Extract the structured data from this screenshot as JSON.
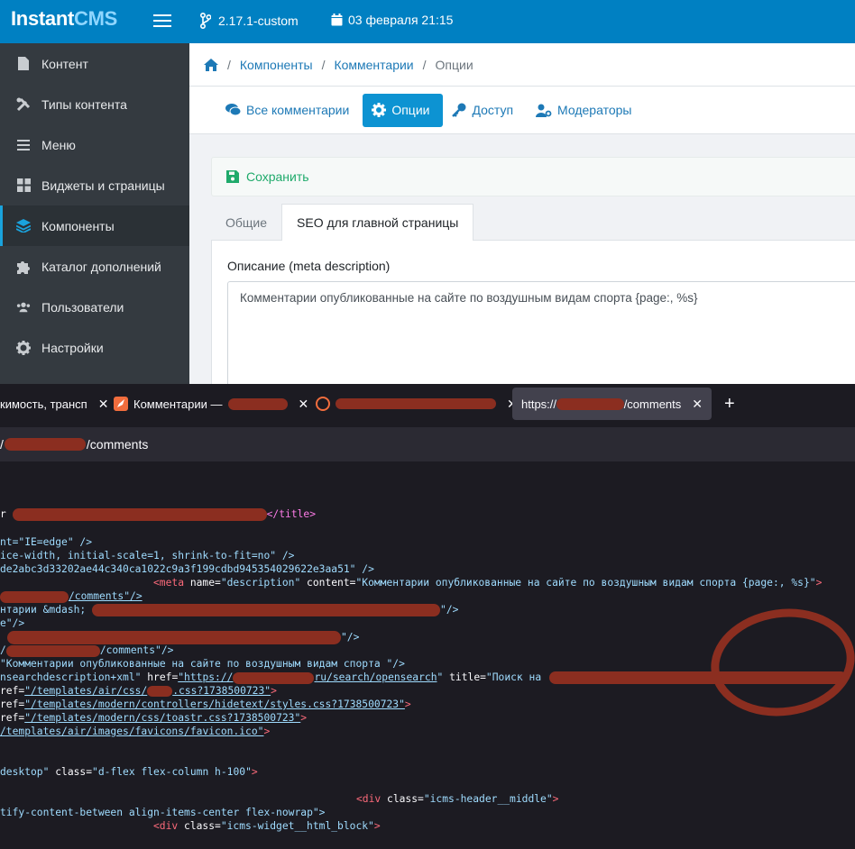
{
  "header": {
    "logo_part1": "Instant",
    "logo_part2": "CMS",
    "version": "2.17.1-custom",
    "datetime": "03 февраля 21:15"
  },
  "sidebar": {
    "items": [
      {
        "label": "Контент",
        "icon": "file-icon"
      },
      {
        "label": "Типы контента",
        "icon": "tools-icon"
      },
      {
        "label": "Меню",
        "icon": "bars-icon"
      },
      {
        "label": "Виджеты и страницы",
        "icon": "grid-icon"
      },
      {
        "label": "Компоненты",
        "icon": "layers-icon"
      },
      {
        "label": "Каталог дополнений",
        "icon": "puzzle-icon"
      },
      {
        "label": "Пользователи",
        "icon": "users-icon"
      },
      {
        "label": "Настройки",
        "icon": "gear-icon"
      }
    ]
  },
  "breadcrumb": {
    "c1": "Компоненты",
    "c2": "Комментарии",
    "c3": "Опции"
  },
  "tabs": {
    "t1": "Все комментарии",
    "t2": "Опции",
    "t3": "Доступ",
    "t4": "Модераторы"
  },
  "save": "Сохранить",
  "inner_tabs": {
    "t1": "Общие",
    "t2": "SEO для главной страницы"
  },
  "field": {
    "label": "Описание (meta description)",
    "value": "Комментарии опубликованные на сайте по воздушным видам спорта {page:, %s}"
  },
  "browser": {
    "tab1": "кимость, трансп",
    "tab2": "Комментарии —",
    "tab3": "",
    "tab4_prefix": "https://",
    "tab4_suffix": "/comments",
    "url_prefix": "/",
    "url_suffix": "/comments"
  },
  "source": {
    "l1a": "r ",
    "l1b": "</title>",
    "l2": "nt=\"IE=edge\" />",
    "l3": "ice-width, initial-scale=1, shrink-to-fit=no\" />",
    "l4": "de2abc3d33202ae44c340ca1022c9a3f199cdbd945354029622e3aa51\" />",
    "l5_tag": "<meta",
    "l5_n1": " name=",
    "l5_v1": "\"description\"",
    "l5_n2": " content=",
    "l5_v2": "\"Комментарии опубликованные на сайте по воздушным видам спорта {page:, %s}\"",
    "l5_end": ">",
    "l6": "/comments\"/>",
    "l7a": "нтарии &mdash; ",
    "l7b": "\"/>",
    "l8": "e\"/>",
    "l9": "\"/>",
    "l10a": "/",
    "l10b": "/comments\"/>",
    "l11": "\"Комментарии опубликованные на сайте по воздушным видам спорта \"/>",
    "l12a": "nsearchdescription+xml\"",
    "l12b": " href=",
    "l12c": "\"https://",
    "l12d": "ru/search/opensearch",
    "l12e": "\"",
    "l12f": " title=",
    "l12g": "\"Поиск на ",
    "l13a": "ref=",
    "l13b": "\"/templates/air/css/",
    "l13c": ".css?1738500723\"",
    "l13d": ">",
    "l14a": "ref=",
    "l14b": "\"/templates/modern/controllers/hidetext/styles.css?1738500723\"",
    "l14c": ">",
    "l15a": "ref=",
    "l15b": "\"/templates/modern/css/toastr.css?1738500723\"",
    "l15c": ">",
    "l16": "/templates/air/images/favicons/favicon.ico\"",
    "l16b": ">",
    "l17a": "desktop\"",
    "l17b": " class=",
    "l17c": "\"d-flex flex-column h-100\"",
    "l17d": ">",
    "l18a": "<div",
    "l18b": " class=",
    "l18c": "\"icms-header__middle\"",
    "l18d": ">",
    "l19": "tify-content-between align-items-center flex-nowrap\">",
    "l20a": "<div",
    "l20b": " class=",
    "l20c": "\"icms-widget__html_block\"",
    "l20d": ">"
  }
}
